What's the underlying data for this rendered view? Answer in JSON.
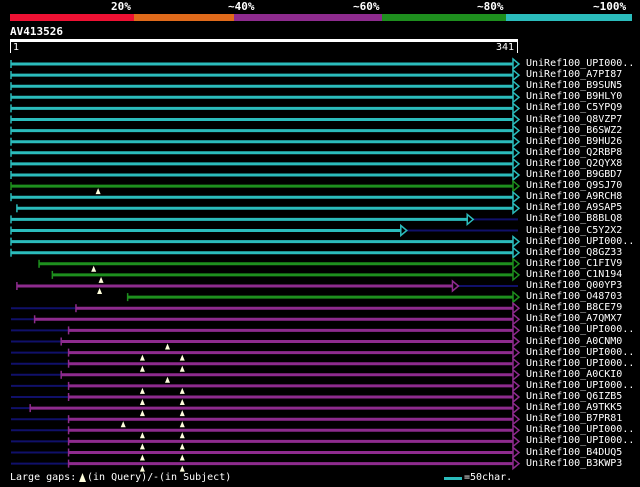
{
  "legend": {
    "segments": [
      {
        "label": "20%",
        "color": "#ee1133"
      },
      {
        "label": "~40%",
        "color": "#e06a1b"
      },
      {
        "label": "~60%",
        "color": "#8e2b8e"
      },
      {
        "label": "~80%",
        "color": "#1e8f1e"
      },
      {
        "label": "~100%",
        "color": "#2bbcbc"
      }
    ]
  },
  "query": {
    "name": "AV413526",
    "start": "1",
    "end": "341",
    "length": 341
  },
  "colors": {
    "cyan": "#2bbcbc",
    "green": "#1e8f1e",
    "purple": "#8e2b8e",
    "gap": "#10106a",
    "marker": "#ffffdd",
    "query_bar": "#ffffff"
  },
  "hits": [
    {
      "name": "UniRef100_UPI000..",
      "color": "cyan",
      "start": 1,
      "end": 341,
      "pre": 0,
      "markers": []
    },
    {
      "name": "UniRef100_A7PI87",
      "color": "cyan",
      "start": 1,
      "end": 341,
      "pre": 0,
      "markers": []
    },
    {
      "name": "UniRef100_B9SUN5",
      "color": "cyan",
      "start": 1,
      "end": 341,
      "pre": 0,
      "markers": []
    },
    {
      "name": "UniRef100_B9HLY0",
      "color": "cyan",
      "start": 1,
      "end": 341,
      "pre": 0,
      "markers": []
    },
    {
      "name": "UniRef100_C5YPQ9",
      "color": "cyan",
      "start": 1,
      "end": 341,
      "pre": 0,
      "markers": []
    },
    {
      "name": "UniRef100_Q8VZP7",
      "color": "cyan",
      "start": 1,
      "end": 341,
      "pre": 0,
      "markers": []
    },
    {
      "name": "UniRef100_B6SWZ2",
      "color": "cyan",
      "start": 1,
      "end": 341,
      "pre": 0,
      "markers": []
    },
    {
      "name": "UniRef100_B9HU26",
      "color": "cyan",
      "start": 1,
      "end": 341,
      "pre": 0,
      "markers": []
    },
    {
      "name": "UniRef100_Q2RBP8",
      "color": "cyan",
      "start": 1,
      "end": 341,
      "pre": 0,
      "markers": []
    },
    {
      "name": "UniRef100_Q2QYX8",
      "color": "cyan",
      "start": 1,
      "end": 341,
      "pre": 0,
      "markers": []
    },
    {
      "name": "UniRef100_B9GBD7",
      "color": "cyan",
      "start": 1,
      "end": 341,
      "pre": 0,
      "markers": []
    },
    {
      "name": "UniRef100_Q9SJ70",
      "color": "green",
      "start": 1,
      "end": 341,
      "pre": 0,
      "markers": [
        60
      ]
    },
    {
      "name": "UniRef100_A9RCH8",
      "color": "cyan",
      "start": 1,
      "end": 341,
      "pre": 0,
      "markers": []
    },
    {
      "name": "UniRef100_A9SAP5",
      "color": "cyan",
      "start": 5,
      "end": 341,
      "pre": 0,
      "markers": []
    },
    {
      "name": "UniRef100_B8BLQ8",
      "color": "cyan",
      "start": 1,
      "end": 310,
      "pre": 0,
      "markers": []
    },
    {
      "name": "UniRef100_C5Y2X2",
      "color": "cyan",
      "start": 1,
      "end": 265,
      "pre": 0,
      "markers": []
    },
    {
      "name": "UniRef100_UPI000..",
      "color": "cyan",
      "start": 1,
      "end": 341,
      "pre": 0,
      "markers": []
    },
    {
      "name": "UniRef100_Q8GZ33",
      "color": "cyan",
      "start": 1,
      "end": 341,
      "pre": 0,
      "markers": []
    },
    {
      "name": "UniRef100_C1FIV9",
      "color": "green",
      "start": 20,
      "end": 341,
      "pre": 0,
      "markers": [
        57
      ]
    },
    {
      "name": "UniRef100_C1N194",
      "color": "green",
      "start": 29,
      "end": 341,
      "pre": 0,
      "markers": [
        62
      ]
    },
    {
      "name": "UniRef100_Q00YP3",
      "color": "purple",
      "start": 5,
      "end": 300,
      "pre": 0,
      "markers": [
        61
      ]
    },
    {
      "name": "UniRef100_O48703",
      "color": "green",
      "start": 80,
      "end": 341,
      "pre": 0,
      "markers": []
    },
    {
      "name": "UniRef100_B8CE79",
      "color": "purple",
      "start": 45,
      "end": 341,
      "pre": 1,
      "markers": []
    },
    {
      "name": "UniRef100_A7QMX7",
      "color": "purple",
      "start": 17,
      "end": 341,
      "pre": 1,
      "markers": []
    },
    {
      "name": "UniRef100_UPI000..",
      "color": "purple",
      "start": 40,
      "end": 341,
      "pre": 1,
      "markers": []
    },
    {
      "name": "UniRef100_A0CNM0",
      "color": "purple",
      "start": 35,
      "end": 341,
      "pre": 1,
      "markers": [
        107
      ]
    },
    {
      "name": "UniRef100_UPI000..",
      "color": "purple",
      "start": 40,
      "end": 341,
      "pre": 1,
      "markers": [
        90,
        117
      ]
    },
    {
      "name": "UniRef100_UPI000..",
      "color": "purple",
      "start": 40,
      "end": 341,
      "pre": 1,
      "markers": [
        90,
        117
      ]
    },
    {
      "name": "UniRef100_A0CKI0",
      "color": "purple",
      "start": 35,
      "end": 341,
      "pre": 1,
      "markers": [
        107
      ]
    },
    {
      "name": "UniRef100_UPI000..",
      "color": "purple",
      "start": 40,
      "end": 341,
      "pre": 1,
      "markers": [
        90,
        117
      ]
    },
    {
      "name": "UniRef100_Q6IZB5",
      "color": "purple",
      "start": 40,
      "end": 341,
      "pre": 1,
      "markers": [
        90,
        117
      ]
    },
    {
      "name": "UniRef100_A9TKK5",
      "color": "purple",
      "start": 14,
      "end": 341,
      "pre": 1,
      "markers": [
        90,
        117
      ]
    },
    {
      "name": "UniRef100_B7PR81",
      "color": "purple",
      "start": 40,
      "end": 341,
      "pre": 1,
      "markers": [
        77,
        117
      ]
    },
    {
      "name": "UniRef100_UPI000..",
      "color": "purple",
      "start": 40,
      "end": 341,
      "pre": 1,
      "markers": [
        90,
        117
      ]
    },
    {
      "name": "UniRef100_UPI000..",
      "color": "purple",
      "start": 40,
      "end": 341,
      "pre": 1,
      "markers": [
        90,
        117
      ]
    },
    {
      "name": "UniRef100_B4DUQ5",
      "color": "purple",
      "start": 40,
      "end": 341,
      "pre": 1,
      "markers": [
        90,
        117
      ]
    },
    {
      "name": "UniRef100_B3KWP3",
      "color": "purple",
      "start": 40,
      "end": 341,
      "pre": 1,
      "markers": [
        90,
        117
      ]
    }
  ],
  "footer": {
    "gaps_text": "Large gaps:",
    "gaps_query_text": "(in Query)/",
    "gaps_subject_text": "(in Subject)",
    "scale_text": "=50char."
  }
}
